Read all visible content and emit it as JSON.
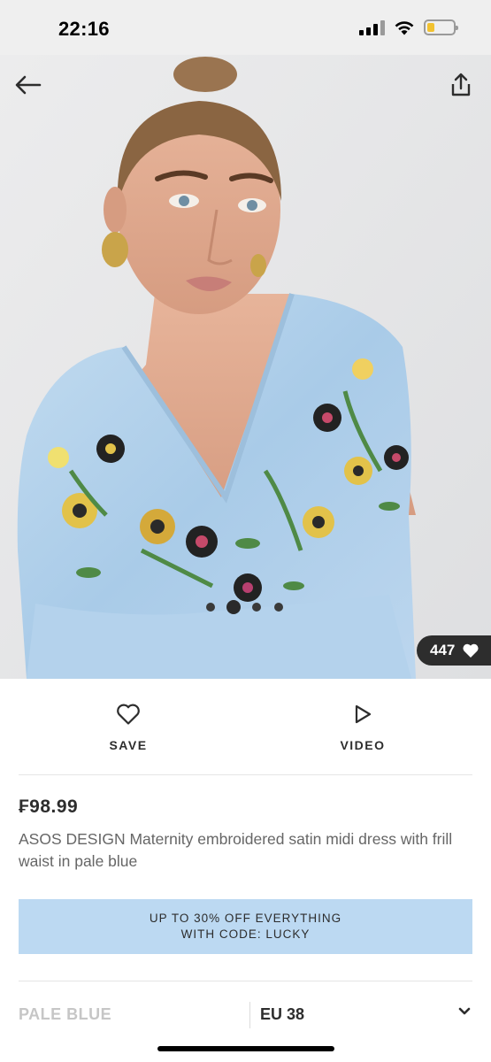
{
  "status_bar": {
    "time": "22:16",
    "battery_level": 0.3
  },
  "product_image": {
    "description_icon": "product-photo"
  },
  "like_badge": {
    "count": "447"
  },
  "actions": {
    "save_label": "SAVE",
    "video_label": "VIDEO"
  },
  "product": {
    "price": "₣98.99",
    "title": "ASOS DESIGN Maternity embroidered satin midi dress with frill waist in pale blue"
  },
  "promo": {
    "line1": "UP TO 30% OFF EVERYTHING",
    "line2": "WITH CODE: LUCKY"
  },
  "options": {
    "colour": "PALE BLUE",
    "size": "EU 38"
  },
  "colors": {
    "promo_bg": "#bcd9f2",
    "dark": "#2d2d2d",
    "muted": "#c6c6c6"
  }
}
